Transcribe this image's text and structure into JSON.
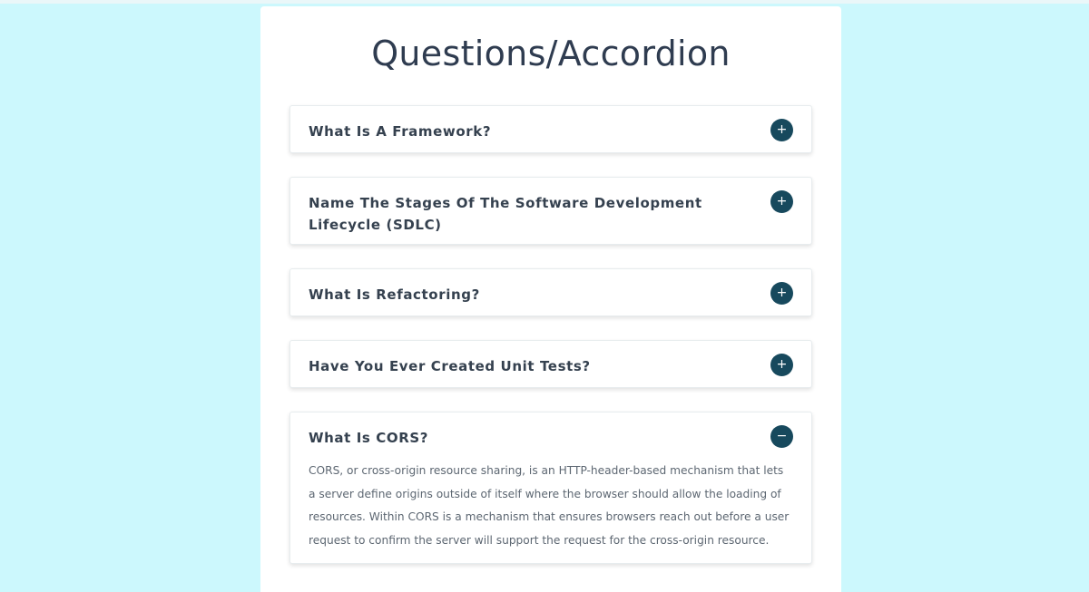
{
  "page": {
    "title": "Questions/Accordion"
  },
  "accordion": {
    "items": [
      {
        "question": "What Is A Framework?",
        "icon": "+",
        "expanded": false
      },
      {
        "question": "Name The Stages Of The Software Development Lifecycle (SDLC)",
        "icon": "+",
        "expanded": false
      },
      {
        "question": "What Is Refactoring?",
        "icon": "+",
        "expanded": false
      },
      {
        "question": "Have You Ever Created Unit Tests?",
        "icon": "+",
        "expanded": false
      },
      {
        "question": "What Is CORS?",
        "icon": "−",
        "expanded": true,
        "answer": "CORS, or cross-origin resource sharing, is an HTTP-header-based mechanism that lets a server define origins outside of itself where the browser should allow the loading of resources. Within CORS is a mechanism that ensures browsers reach out before a user request to confirm the server will support the request for the cross-origin resource."
      }
    ]
  },
  "colors": {
    "page_background": "#ccf8fd",
    "card_background": "#ffffff",
    "title_text": "#2f3c50",
    "toggle_background": "#17495d",
    "answer_text": "#5d6772"
  }
}
